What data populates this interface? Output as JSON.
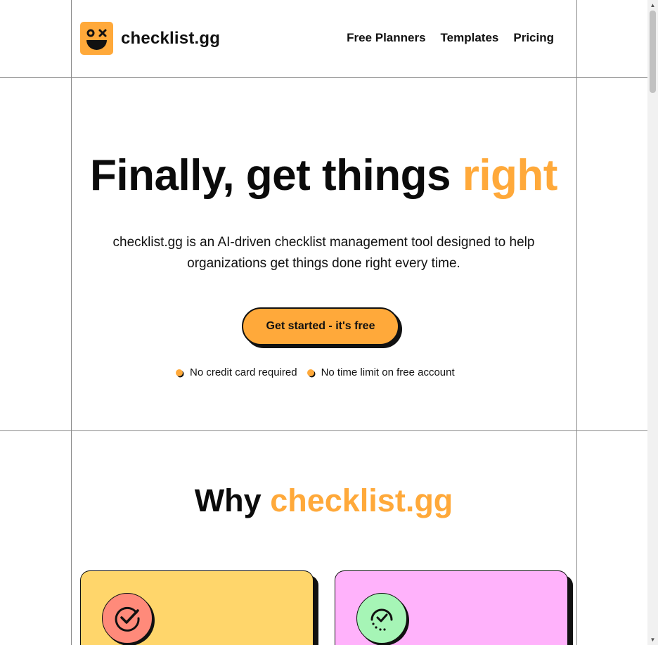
{
  "header": {
    "logo_text": "checklist.gg",
    "logo_icon": "smiley-face-icon",
    "nav": [
      {
        "label": "Free Planners"
      },
      {
        "label": "Templates"
      },
      {
        "label": "Pricing"
      }
    ]
  },
  "hero": {
    "title_main": "Finally, get things ",
    "title_accent": "right",
    "subtitle": "checklist.gg is an AI-driven checklist management tool designed to help organizations get things done right every time.",
    "cta_label": "Get started - it's free",
    "perks": [
      {
        "label": "No credit card required"
      },
      {
        "label": "No time limit on free account"
      }
    ]
  },
  "why": {
    "title_main": "Why ",
    "title_accent": "checklist.gg",
    "cards": [
      {
        "icon": "check-circle-icon",
        "color": "#ffd66b"
      },
      {
        "icon": "progress-check-icon",
        "color": "#ffb2fb"
      }
    ]
  },
  "colors": {
    "accent": "#ffa93a",
    "text": "#111111",
    "lines": "#8a8a8a"
  }
}
